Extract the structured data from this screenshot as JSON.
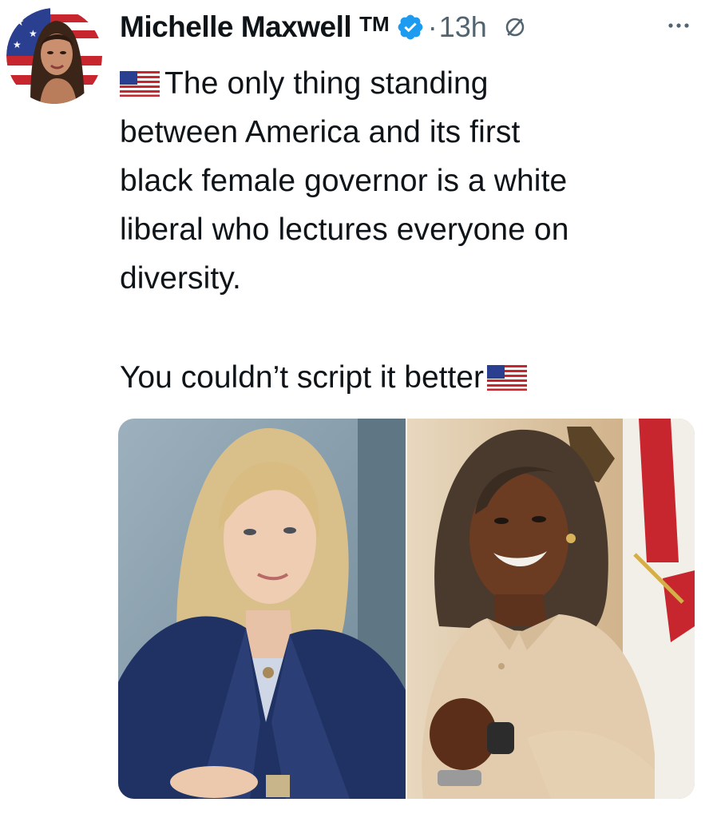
{
  "tweet": {
    "author_name": "Michelle Maxwell",
    "author_badge_text": "TM",
    "separator": "·",
    "time": "13h",
    "line1": "The only thing standing",
    "line2": "between America and its first",
    "line3": "black female governor is a white",
    "line4": "liberal who lectures everyone on",
    "line5": "diversity.",
    "closing": "You couldn’t script it better"
  },
  "icons": {
    "verified": "verified-badge-icon",
    "no_reply": "no-reply-icon",
    "more": "more-icon",
    "flag": "us-flag-icon"
  },
  "colors": {
    "text": "#0f1419",
    "secondary": "#536471",
    "verified": "#1d9bf0"
  }
}
